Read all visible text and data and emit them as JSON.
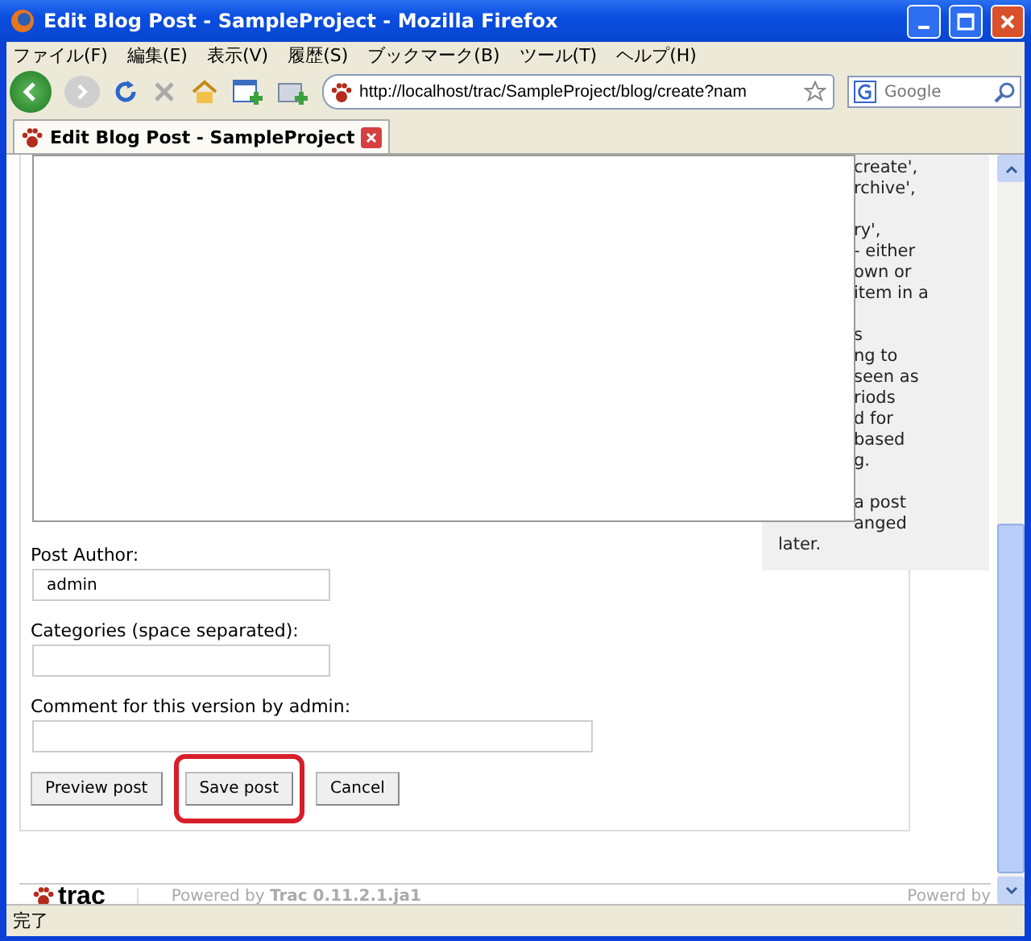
{
  "window": {
    "title": "Edit Blog Post - SampleProject - Mozilla Firefox"
  },
  "menu": [
    "ファイル(F)",
    "編集(E)",
    "表示(V)",
    "履歴(S)",
    "ブックマーク(B)",
    "ツール(T)",
    "ヘルプ(H)"
  ],
  "toolbar": {
    "url": "http://localhost/trac/SampleProject/blog/create?nam",
    "search": {
      "placeholder": "Google"
    }
  },
  "tabs": [
    {
      "label": "Edit Blog Post - SampleProject",
      "selected": true
    }
  ],
  "sidebar": {
    "paragraphs": [
      {
        "lines": [
          {
            "text": "create',",
            "kind": "beside"
          },
          {
            "text": "rchive',",
            "kind": "beside"
          }
        ]
      },
      {
        "lines": [
          {
            "text": "ry',",
            "kind": "beside"
          },
          {
            "text": "- either",
            "kind": "beside"
          },
          {
            "text": "own or",
            "kind": "beside"
          },
          {
            "text": "item in a",
            "kind": "beside"
          }
        ]
      },
      {
        "lines": [
          {
            "text": "s",
            "kind": "beside"
          },
          {
            "text": "ng to",
            "kind": "beside"
          },
          {
            "text": "seen as",
            "kind": "beside"
          },
          {
            "text": "riods",
            "kind": "beside"
          },
          {
            "text": "d for",
            "kind": "beside"
          },
          {
            "text": "based",
            "kind": "beside"
          },
          {
            "text": "g.",
            "kind": "beside"
          }
        ]
      },
      {
        "lines": [
          {
            "text": "a post",
            "kind": "beside"
          },
          {
            "text": "anged",
            "kind": "beside"
          },
          {
            "text": "later.",
            "kind": "below"
          }
        ]
      }
    ]
  },
  "form": {
    "fields": [
      {
        "label": "Post Author:",
        "value": "admin",
        "kind": "short"
      },
      {
        "label": "Categories (space separated):",
        "kind": "short"
      },
      {
        "label": "Comment for this version by admin:",
        "kind": "long"
      }
    ],
    "buttons": [
      {
        "label": "Preview post",
        "highlighted": false
      },
      {
        "label": "Save post",
        "highlighted": true
      },
      {
        "label": "Cancel",
        "highlighted": false
      }
    ]
  },
  "footer": {
    "logo": "trac",
    "powered": "Powered by **Trac 0.11.2.1.ja1**",
    "right": "Powerd by"
  },
  "status_bar": "完了"
}
